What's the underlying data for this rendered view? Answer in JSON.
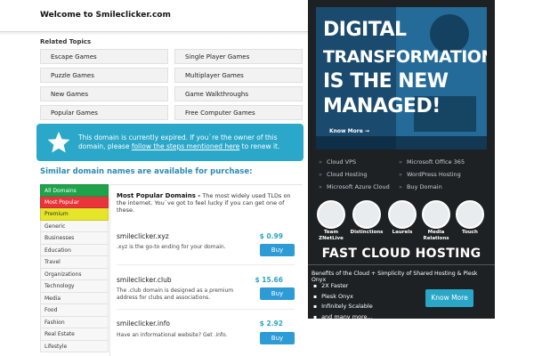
{
  "header": {
    "welcome": "Welcome to Smileclicker.com"
  },
  "related": {
    "title": "Related Topics",
    "topics": [
      "Escape Games",
      "Single Player Games",
      "Puzzle Games",
      "Multiplayer Games",
      "New Games",
      "Game Walkthroughs",
      "Popular Games",
      "Free Computer Games"
    ]
  },
  "banner": {
    "text_before": "This domain is currently expired. If you`re the owner of this domain, please ",
    "link": "follow the steps mentioned here",
    "text_after": " to renew it.",
    "icon": "star-icon"
  },
  "similar": {
    "title": "Similar domain names are available for purchase:"
  },
  "categories": [
    "All Domains",
    "Most Popular",
    "Premium",
    "Generic",
    "Businesses",
    "Education",
    "Travel",
    "Organizations",
    "Technology",
    "Media",
    "Food",
    "Fashion",
    "Real Estate",
    "Lifestyle"
  ],
  "popular": {
    "heading": "Most Popular Domains -",
    "text": " The most widely used TLDs on the internet. You`ve got to feel lucky if you can get one of these."
  },
  "domains": [
    {
      "name": "smileclicker.xyz",
      "price": "$ 0.99",
      "desc": ".xyz is the go-to ending for your domain.",
      "buy": "Buy"
    },
    {
      "name": "smileclicker.club",
      "price": "$ 15.66",
      "desc": "The .club domain is designed as a premium address for clubs and associations.",
      "buy": "Buy"
    },
    {
      "name": "smileclicker.info",
      "price": "$ 2.92",
      "desc": "Have an informational website? Get .info.",
      "buy": "Buy"
    }
  ],
  "ad": {
    "hero_lines": [
      "DIGITAL",
      "TRANSFORMATION",
      "IS THE NEW",
      "MANAGED!"
    ],
    "know_more": "Know More",
    "services": [
      "Cloud VPS",
      "Microsoft Office 365",
      "Cloud Hosting",
      "WordPress Hosting",
      "Microsoft Azure Cloud",
      "Buy Domain"
    ],
    "circles": [
      "Team ZNetLive",
      "Distinctions",
      "Laurels",
      "Media Relations",
      "Touch"
    ],
    "fch_title": "FAST CLOUD HOSTING",
    "fch_desc": "Benefits of the Cloud + Simplicity of Shared Hosting & Plesk Onyx",
    "fch_list": [
      "2X Faster",
      "Plesk Onyx",
      "Infinitely Scalable",
      "and many more..."
    ],
    "fch_button": "Know More"
  }
}
